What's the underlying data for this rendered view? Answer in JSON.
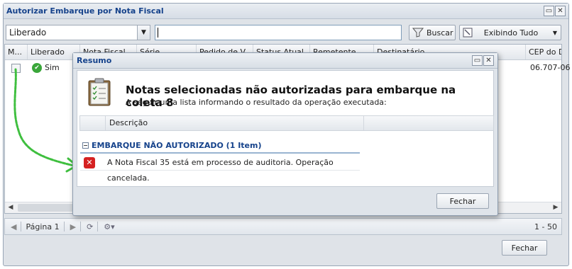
{
  "window": {
    "title": "Autorizar Embarque por Nota Fiscal"
  },
  "toolbar": {
    "status_select": "Liberado",
    "search_value": "",
    "search_button": "Buscar",
    "view_button": "Exibindo Tudo"
  },
  "grid": {
    "headers": [
      "M...",
      "Liberado",
      "Nota Fiscal",
      "Série",
      "Pedido de V...",
      "Status Atual",
      "Remetente",
      "Destinatário",
      "CEP do De..."
    ],
    "row": {
      "liberado": "Sim",
      "cep": "06.707-06"
    }
  },
  "paging": {
    "page": "Página 1",
    "range": "1 - 50"
  },
  "footer": {
    "close_button": "Fechar"
  },
  "modal": {
    "title": "Resumo",
    "heading": "Notas selecionadas não autorizadas para embarque na coleta 8",
    "subheading": "A seguir uma lista informando o resultado da operação executada:",
    "column": "Descrição",
    "group": "EMBARQUE NÃO AUTORIZADO (1 Item)",
    "message": "A Nota Fiscal 35 está em processo de auditoria. Operação cancelada.",
    "close_button": "Fechar"
  },
  "colors": {
    "title": "#15428b",
    "error": "#d52121",
    "success": "#3aa63a",
    "annotation": "#3fbf3f"
  },
  "icons": [
    "maximize-icon",
    "close-icon",
    "filter-icon",
    "grid-view-icon",
    "check-icon",
    "refresh-icon",
    "gear-icon",
    "clipboard-icon",
    "error-icon"
  ]
}
